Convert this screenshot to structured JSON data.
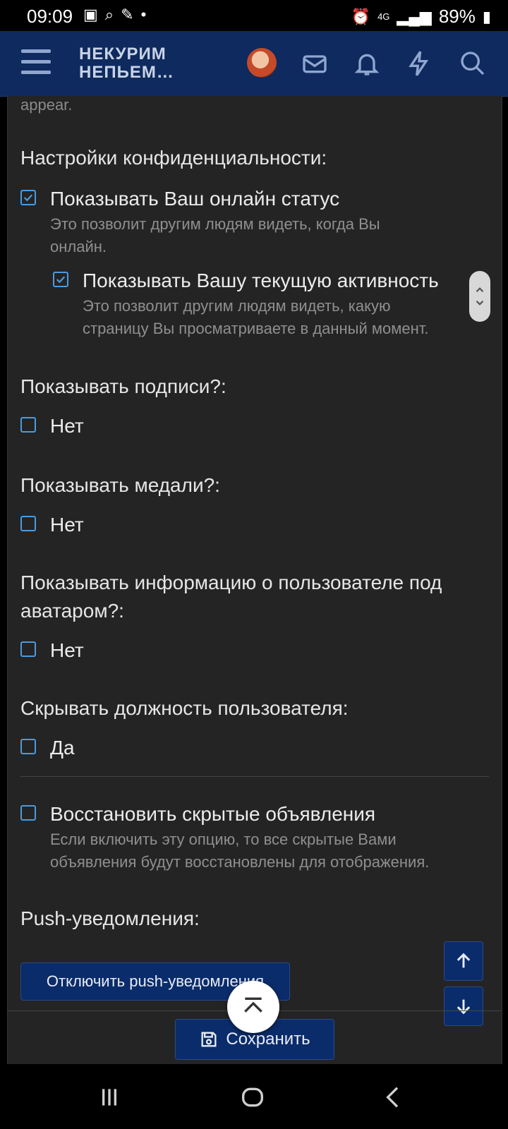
{
  "status_bar": {
    "time": "09:09",
    "battery": "89%",
    "network": "4G"
  },
  "header": {
    "brand_line1": "НЕКУРИМ",
    "brand_line2": "НЕПЬЕМ…",
    "icons": [
      "menu-icon",
      "avatar",
      "mail-icon",
      "bell-icon",
      "bolt-icon",
      "search-icon"
    ]
  },
  "content": {
    "faint_text": "appear.",
    "privacy": {
      "title": "Настройки конфиденциальности:",
      "online_status": {
        "label": "Показывать Ваш онлайн статус",
        "hint1": "Это позволит другим людям видеть, когда Вы",
        "hint2": "онлайн.",
        "checked": true
      },
      "activity": {
        "label": "Показывать Вашу текущую активность",
        "hint1": "Это позволит другим людям видеть, какую",
        "hint2": "страницу Вы просматриваете в данный момент.",
        "checked": true
      }
    },
    "signatures": {
      "title": "Показывать подписи?:",
      "option": "Нет",
      "checked": false
    },
    "medals": {
      "title": "Показывать медали?:",
      "option": "Нет",
      "checked": false
    },
    "user_info": {
      "title1": "Показывать информацию о пользователе под",
      "title2": "аватаром?:",
      "option": "Нет",
      "checked": false
    },
    "hide_title": {
      "title": "Скрывать должность пользователя:",
      "option": "Да",
      "checked": false
    },
    "restore": {
      "label": "Восстановить скрытые объявления",
      "hint1": "Если включить эту опцию, то все скрытые Вами",
      "hint2": "объявления будут восстановлены для отображения.",
      "checked": false
    },
    "push": {
      "title": "Push-уведомления:",
      "button": "Отключить push-уведомления"
    }
  },
  "footer": {
    "save_label": "Сохранить"
  },
  "colors": {
    "header_bg": "#0e2a5e",
    "content_bg": "#242424",
    "checkbox": "#4a9be0",
    "button_bg": "#0b2c6a"
  }
}
